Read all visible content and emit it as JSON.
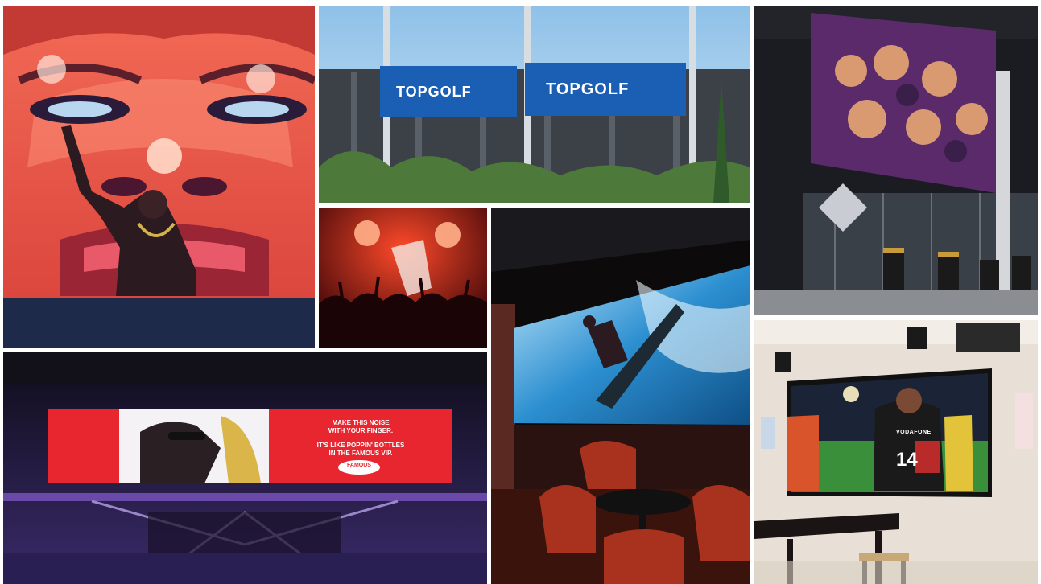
{
  "collage": {
    "tiles": [
      {
        "id": "concert-face-mural"
      },
      {
        "id": "topgolf-signage"
      },
      {
        "id": "stadium-video-wall"
      },
      {
        "id": "nightclub-crowd"
      },
      {
        "id": "surf-led-wall"
      },
      {
        "id": "club-stage-screen"
      },
      {
        "id": "sports-bar-screen"
      }
    ]
  },
  "topgolf": {
    "sign_left": "TOPGOLF",
    "sign_right": "TOPGOLF"
  },
  "club_screen": {
    "line1": "MAKE THIS NOISE",
    "line2": "WITH YOUR FINGER.",
    "line3": "IT'S LIKE POPPIN' BOTTLES",
    "line4": "IN THE FAMOUS VIP.",
    "logo_text": "FAMOUS"
  },
  "sports_screen": {
    "jersey_number": "14",
    "sponsor_text": "VODAFONE"
  },
  "colors": {
    "mural_red": "#e8503f",
    "topgolf_blue": "#1a5fb4",
    "club_red": "#e8262f",
    "stage_purple": "#3a2b6b",
    "ocean_blue": "#2c8fd0",
    "field_green": "#3a8f3a"
  }
}
